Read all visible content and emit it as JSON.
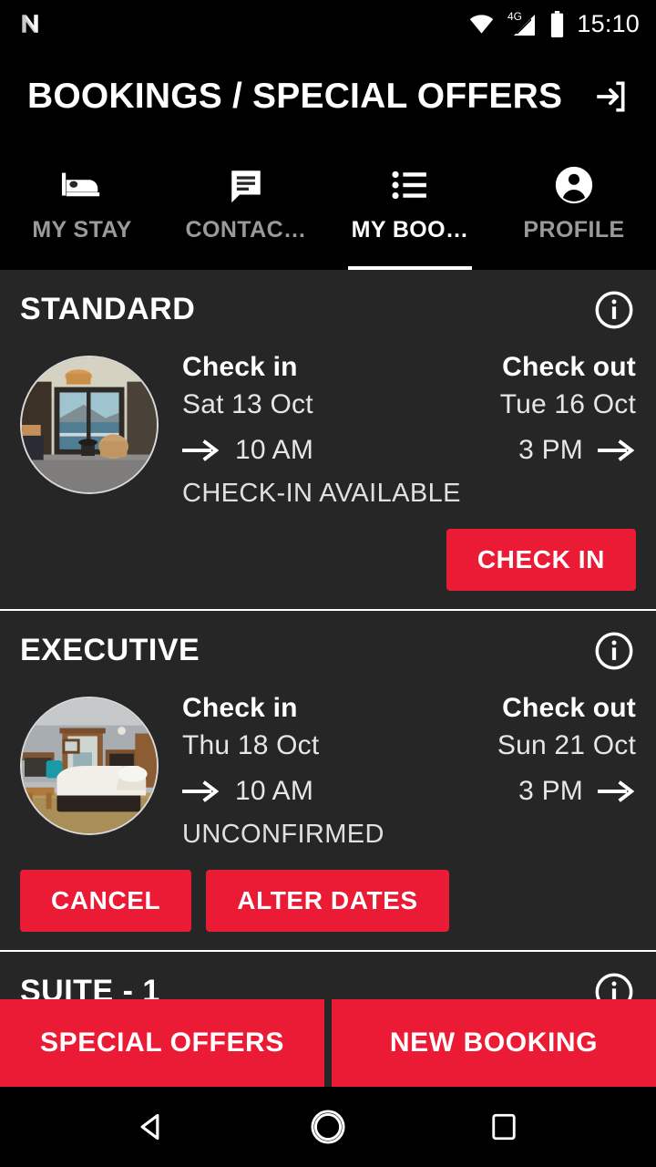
{
  "statusbar": {
    "os_icon": "android-n-icon",
    "wifi_icon": "wifi-icon",
    "network_label": "4G",
    "signal_icon": "signal-bars-icon",
    "battery_icon": "battery-full-icon",
    "time": "15:10"
  },
  "appbar": {
    "title": "BOOKINGS / SPECIAL OFFERS",
    "action_icon": "exit-to-app-icon"
  },
  "tabs": [
    {
      "label": "MY STAY",
      "icon": "bed-icon",
      "active": false
    },
    {
      "label": "CONTAC…",
      "icon": "chat-icon",
      "active": false
    },
    {
      "label": "MY BOO…",
      "icon": "list-icon",
      "active": true
    },
    {
      "label": "PROFILE",
      "icon": "person-icon",
      "active": false
    }
  ],
  "bookings": [
    {
      "title": "STANDARD",
      "info_icon": "info-icon",
      "thumb_name": "room-photo-sea-view",
      "check_in_label": "Check in",
      "check_in_date": "Sat 13 Oct",
      "check_in_time": "10 AM",
      "check_out_label": "Check out",
      "check_out_date": "Tue 16 Oct",
      "check_out_time": "3 PM",
      "status": "CHECK-IN AVAILABLE",
      "actions": [
        "CHECK IN"
      ]
    },
    {
      "title": "EXECUTIVE",
      "info_icon": "info-icon",
      "thumb_name": "room-photo-bedroom",
      "check_in_label": "Check in",
      "check_in_date": "Thu 18 Oct",
      "check_in_time": "10 AM",
      "check_out_label": "Check out",
      "check_out_date": "Sun 21 Oct",
      "check_out_time": "3 PM",
      "status": "UNCONFIRMED",
      "actions": [
        "CANCEL",
        "ALTER DATES"
      ]
    },
    {
      "title": "SUITE  - 1",
      "info_icon": "info-icon"
    }
  ],
  "bottombar": {
    "special_offers_label": "SPECIAL OFFERS",
    "new_booking_label": "NEW BOOKING"
  },
  "navbar": {
    "back_icon": "back-triangle-icon",
    "home_icon": "home-circle-icon",
    "recents_icon": "recents-square-icon"
  },
  "colors": {
    "accent_red": "#EB1B35",
    "card_bg": "#262626",
    "chrome_bg": "#000000",
    "text_primary": "#FFFFFF",
    "text_muted": "#9A9A9A"
  }
}
